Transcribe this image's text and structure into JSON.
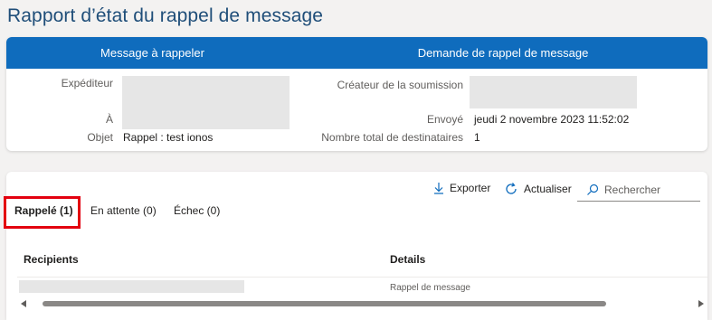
{
  "page": {
    "title": "Rapport d’état du rappel de message"
  },
  "summary": {
    "left_header": "Message à rappeler",
    "right_header": "Demande de rappel de message",
    "sender_label": "Expéditeur",
    "to_label": "À",
    "subject_label": "Objet",
    "subject_value": "Rappel : test ionos",
    "creator_label": "Créateur de la soumission",
    "sent_label": "Envoyé",
    "sent_value": "jeudi 2 novembre 2023 11:52:02",
    "total_label": "Nombre total de destinataires",
    "total_value": "1"
  },
  "toolbar": {
    "export_label": "Exporter",
    "refresh_label": "Actualiser",
    "search_placeholder": "Rechercher"
  },
  "tabs": [
    {
      "label": "Rappelé (1)",
      "active": true
    },
    {
      "label": "En attente (0)",
      "active": false
    },
    {
      "label": "Échec (0)",
      "active": false
    }
  ],
  "table": {
    "columns": [
      "Recipients",
      "Details"
    ],
    "rows": [
      {
        "recipient": "",
        "details": "Rappel de message"
      }
    ]
  },
  "colors": {
    "header_blue": "#0f6cbd",
    "title_blue": "#1f4e79",
    "highlight_red": "#e3000f"
  }
}
